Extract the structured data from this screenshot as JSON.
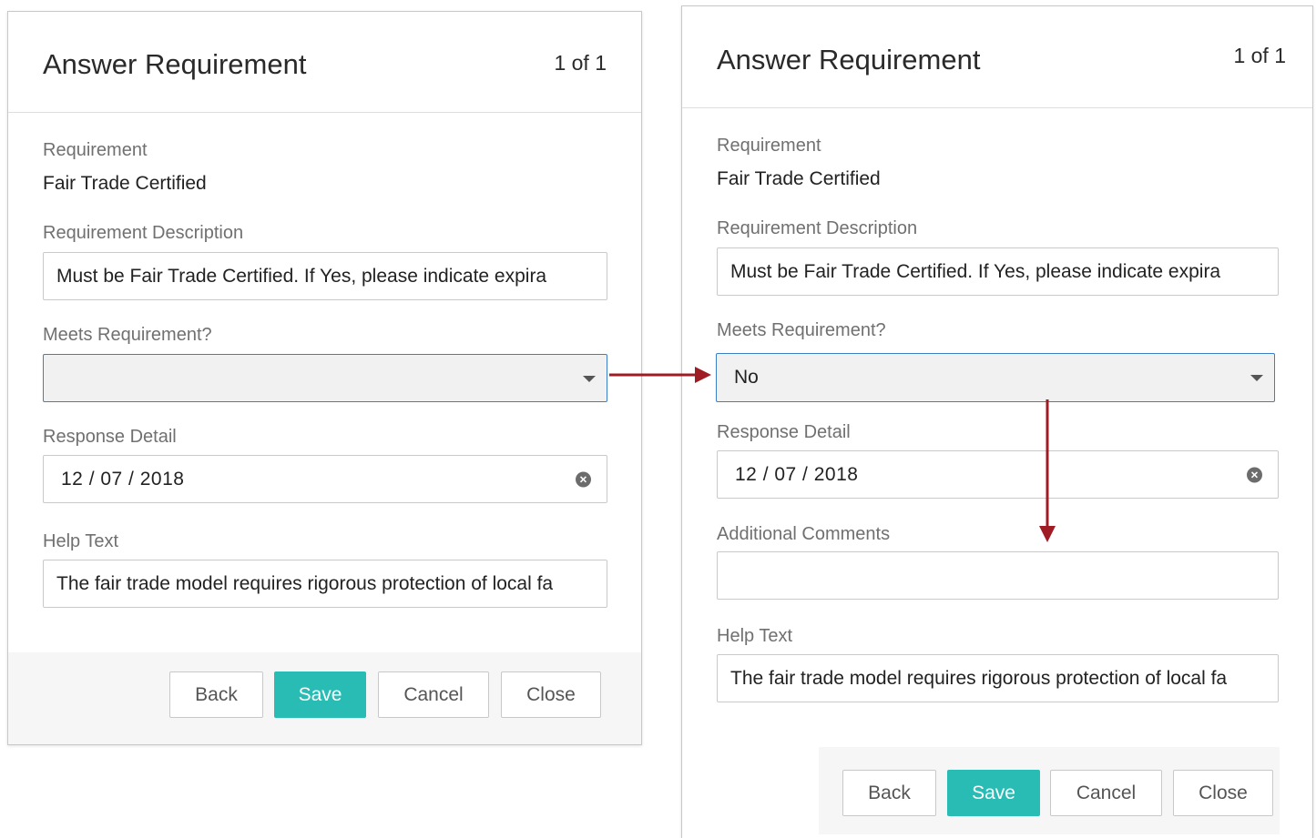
{
  "left_dialog": {
    "title": "Answer Requirement",
    "counter": "1 of 1",
    "requirement_label": "Requirement",
    "requirement_value": "Fair Trade Certified",
    "description_label": "Requirement Description",
    "description_value": "Must be Fair Trade Certified. If Yes, please indicate expira",
    "meets_label": "Meets Requirement?",
    "meets_value": "",
    "response_label": "Response Detail",
    "response_value": "12 / 07 / 2018",
    "help_label": "Help Text",
    "help_value": "The fair trade model requires rigorous protection of local  fa",
    "buttons": {
      "back": "Back",
      "save": "Save",
      "cancel": "Cancel",
      "close": "Close"
    }
  },
  "right_dialog": {
    "title": "Answer Requirement",
    "counter": "1 of 1",
    "requirement_label": "Requirement",
    "requirement_value": "Fair Trade Certified",
    "description_label": "Requirement Description",
    "description_value": "Must be Fair Trade Certified. If Yes, please indicate expira",
    "meets_label": "Meets Requirement?",
    "meets_value": "No",
    "response_label": "Response Detail",
    "response_value": "12 / 07 / 2018",
    "comments_label": "Additional Comments",
    "comments_value": "",
    "help_label": "Help Text",
    "help_value": "The fair trade model requires rigorous protection of local fa",
    "buttons": {
      "back": "Back",
      "save": "Save",
      "cancel": "Cancel",
      "close": "Close"
    }
  },
  "colors": {
    "primary_button": "#28bcb5",
    "select_focus_border": "#3d7fc6",
    "annotation_arrow": "#a01c25"
  },
  "icons": [
    "dropdown-caret-icon",
    "clear-icon",
    "arrow-right-annotation",
    "arrow-down-annotation"
  ]
}
